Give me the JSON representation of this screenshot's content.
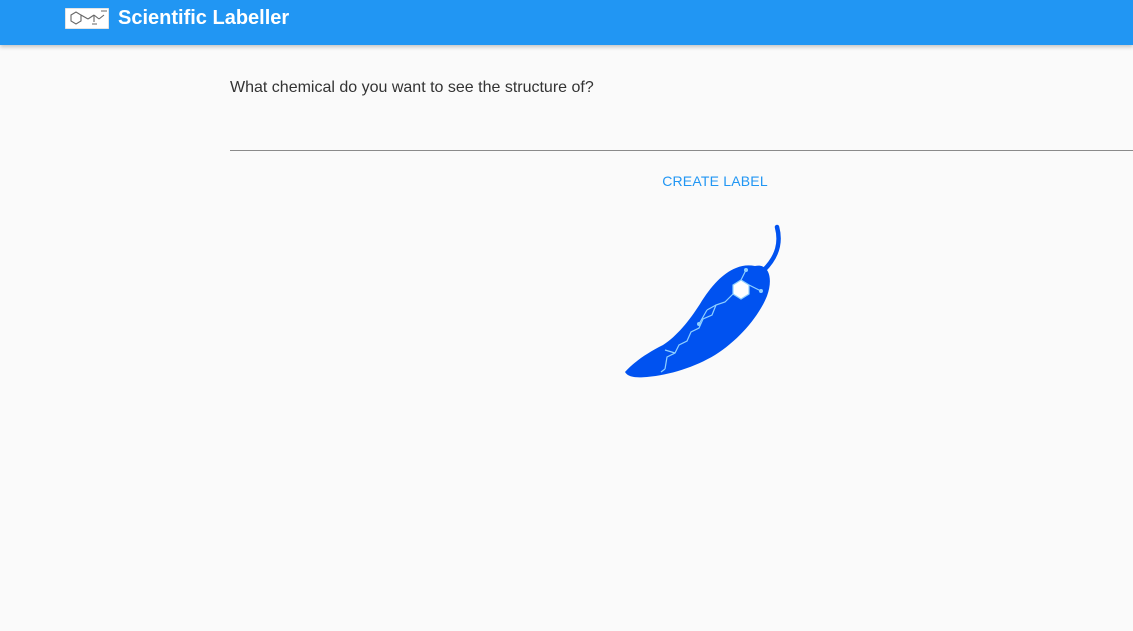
{
  "header": {
    "title": "Scientific Labeller",
    "logo_icon": "molecule-structure-icon",
    "background_color": "#2196f3"
  },
  "main": {
    "prompt": "What chemical do you want to see the structure of?",
    "input_value": "",
    "create_button_label": "CREATE LABEL",
    "illustration_icon": "chili-pepper-capsaicin-icon",
    "accent_color": "#2196f3",
    "illustration_color": "#0052f0"
  }
}
